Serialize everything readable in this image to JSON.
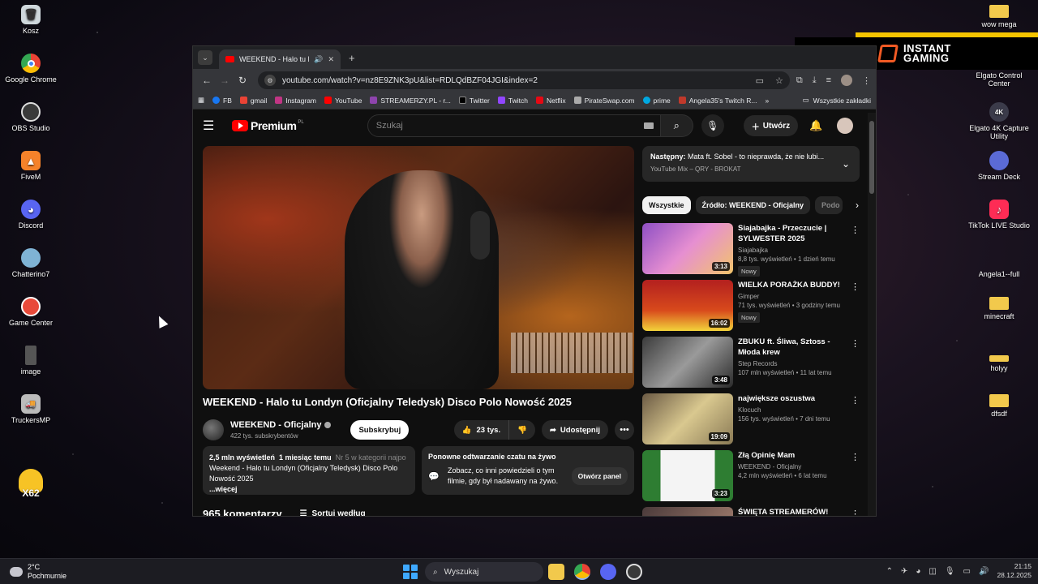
{
  "desktop": {
    "left_icons": [
      {
        "label": "Kosz",
        "icon": "recycle-bin-icon",
        "color": "#cfd8dc"
      },
      {
        "label": "Google Chrome",
        "icon": "chrome-icon",
        "color": "#4285f4"
      },
      {
        "label": "OBS Studio",
        "icon": "obs-icon",
        "color": "#3a3a3a"
      },
      {
        "label": "FiveM",
        "icon": "fivem-icon",
        "color": "#f5822a"
      },
      {
        "label": "Discord",
        "icon": "discord-icon",
        "color": "#5865f2"
      },
      {
        "label": "Chatterino7",
        "icon": "chatterino-icon",
        "color": "#7fb3d5"
      },
      {
        "label": "Game Center",
        "icon": "game-center-icon",
        "color": "#e84a3a"
      },
      {
        "label": "image",
        "icon": "image-file-icon",
        "color": "#555"
      },
      {
        "label": "TruckersMP",
        "icon": "truckersmp-icon",
        "color": "#bbb"
      }
    ],
    "right_icons": [
      {
        "label": "wow mega",
        "icon": "folder-icon",
        "color": "#f2c94c"
      },
      {
        "label": "Elgato Control Center",
        "icon": "elgato-control-icon",
        "color": "#444"
      },
      {
        "label": "Elgato 4K Capture Utility",
        "icon": "elgato-4k-icon",
        "color": "#3b3b4a"
      },
      {
        "label": "Stream Deck",
        "icon": "stream-deck-icon",
        "color": "#5b6bd6"
      },
      {
        "label": "TikTok LIVE Studio",
        "icon": "tiktok-icon",
        "color": "#fe2c55"
      },
      {
        "label": "Angela1--full",
        "icon": "file-icon",
        "color": "#222"
      },
      {
        "label": "minecraft",
        "icon": "folder-icon",
        "color": "#f2c94c"
      },
      {
        "label": "holyy",
        "icon": "folder-icon",
        "color": "#f2c94c"
      },
      {
        "label": "dfsdf",
        "icon": "folder-icon",
        "color": "#f2c94c"
      }
    ],
    "duck_badge": "X62",
    "instant_gaming": {
      "line1": "INSTANT",
      "line2": "GAMING"
    }
  },
  "browser": {
    "tab": {
      "title": "WEEKEND - Halo tu Londyn",
      "audio_icon": "speaker-icon",
      "close": "✕"
    },
    "new_tab": "+",
    "url": "youtube.com/watch?v=nz8E9ZNK3pU&list=RDLQdBZF04JGI&index=2",
    "bookmarks": [
      {
        "label": "FB",
        "color": "#1877f2"
      },
      {
        "label": "gmail",
        "color": "#ea4335"
      },
      {
        "label": "Instagram",
        "color": "#c13584"
      },
      {
        "label": "YouTube",
        "color": "#ff0000"
      },
      {
        "label": "STREAMERZY.PL - r...",
        "color": "#8e44ad"
      },
      {
        "label": "Twitter",
        "color": "#000000"
      },
      {
        "label": "Twitch",
        "color": "#9146ff"
      },
      {
        "label": "Netflix",
        "color": "#e50914"
      },
      {
        "label": "PirateSwap.com",
        "color": "#aaaaaa"
      },
      {
        "label": "prime",
        "color": "#00a8e1"
      },
      {
        "label": "Angela35's Twitch R...",
        "color": "#c0392b"
      }
    ],
    "bookmarks_more": "»",
    "all_bookmarks": "Wszystkie zakładki"
  },
  "youtube": {
    "brand": "Premium",
    "brand_sup": "PL",
    "search_placeholder": "Szukaj",
    "create_label": "Utwórz",
    "video": {
      "title": "WEEKEND - Halo tu Londyn (Oficjalny Teledysk) Disco Polo Nowość 2025",
      "channel": "WEEKEND - Oficjalny",
      "subscribers": "422 tys. subskrybentów",
      "subscribe_label": "Subskrybuj",
      "likes": "23 tys.",
      "share_label": "Udostępnij",
      "views": "2,5 mln wyświetleń",
      "age": "1 miesiąc temu",
      "category": "Nr 5 w kategorii najpo",
      "description": "Weekend - Halo tu Londyn (Oficjalny Teledysk) Disco Polo Nowość 2025",
      "more": "...więcej"
    },
    "replay": {
      "title": "Ponowne odtwarzanie czatu na żywo",
      "text": "Zobacz, co inni powiedzieli o tym filmie, gdy był nadawany na żywo.",
      "button": "Otwórz panel"
    },
    "comments": {
      "count": "965 komentarzy",
      "sort": "Sortuj według"
    },
    "next": {
      "prefix": "Następny:",
      "title": "Mata ft. Sobel - to nieprawda, że nie lubi...",
      "sub": "YouTube Mix – QRY - BROKAT"
    },
    "chips": [
      "Wszystkie",
      "Źródło: WEEKEND - Oficjalny",
      "Podo"
    ],
    "recommendations": [
      {
        "title": "Siajabajka - Przeczucie | SYLWESTER 2025",
        "channel": "Siajabajka",
        "meta": "8,8 tys. wyświetleń • 1 dzień temu",
        "badge": "Nowy",
        "duration": "3:13",
        "thumb": "#8e4fc4"
      },
      {
        "title": "WIELKA PORAŻKA BUDDY!",
        "channel": "Gimper",
        "meta": "71 tys. wyświetleń • 3 godziny temu",
        "badge": "Nowy",
        "duration": "16:02",
        "thumb": "#b3201f"
      },
      {
        "title": "ZBUKU ft. Śliwa, Sztoss - Młoda krew",
        "channel": "Step Records",
        "meta": "107 mln wyświetleń • 11 lat temu",
        "badge": "",
        "duration": "3:48",
        "thumb": "#6b6b6b"
      },
      {
        "title": "największe oszustwa",
        "channel": "Klocuch",
        "meta": "156 tys. wyświetleń • 7 dni temu",
        "badge": "",
        "duration": "19:09",
        "thumb": "#c9b27a"
      },
      {
        "title": "Złą Opinię Mam",
        "channel": "WEEKEND - Oficjalny",
        "meta": "4,2 mln wyświetleń • 6 lat temu",
        "badge": "",
        "duration": "3:23",
        "thumb": "#e8e8e8"
      },
      {
        "title": "ŚWIĘTA STREAMERÓW! XAYOO",
        "channel": "",
        "meta": "",
        "badge": "",
        "duration": "",
        "thumb": "#4a3a3a"
      }
    ]
  },
  "taskbar": {
    "temperature": "2°C",
    "weather": "Pochmurnie",
    "search_label": "Wyszukaj",
    "time": "21:15",
    "date": "28.12.2025"
  }
}
